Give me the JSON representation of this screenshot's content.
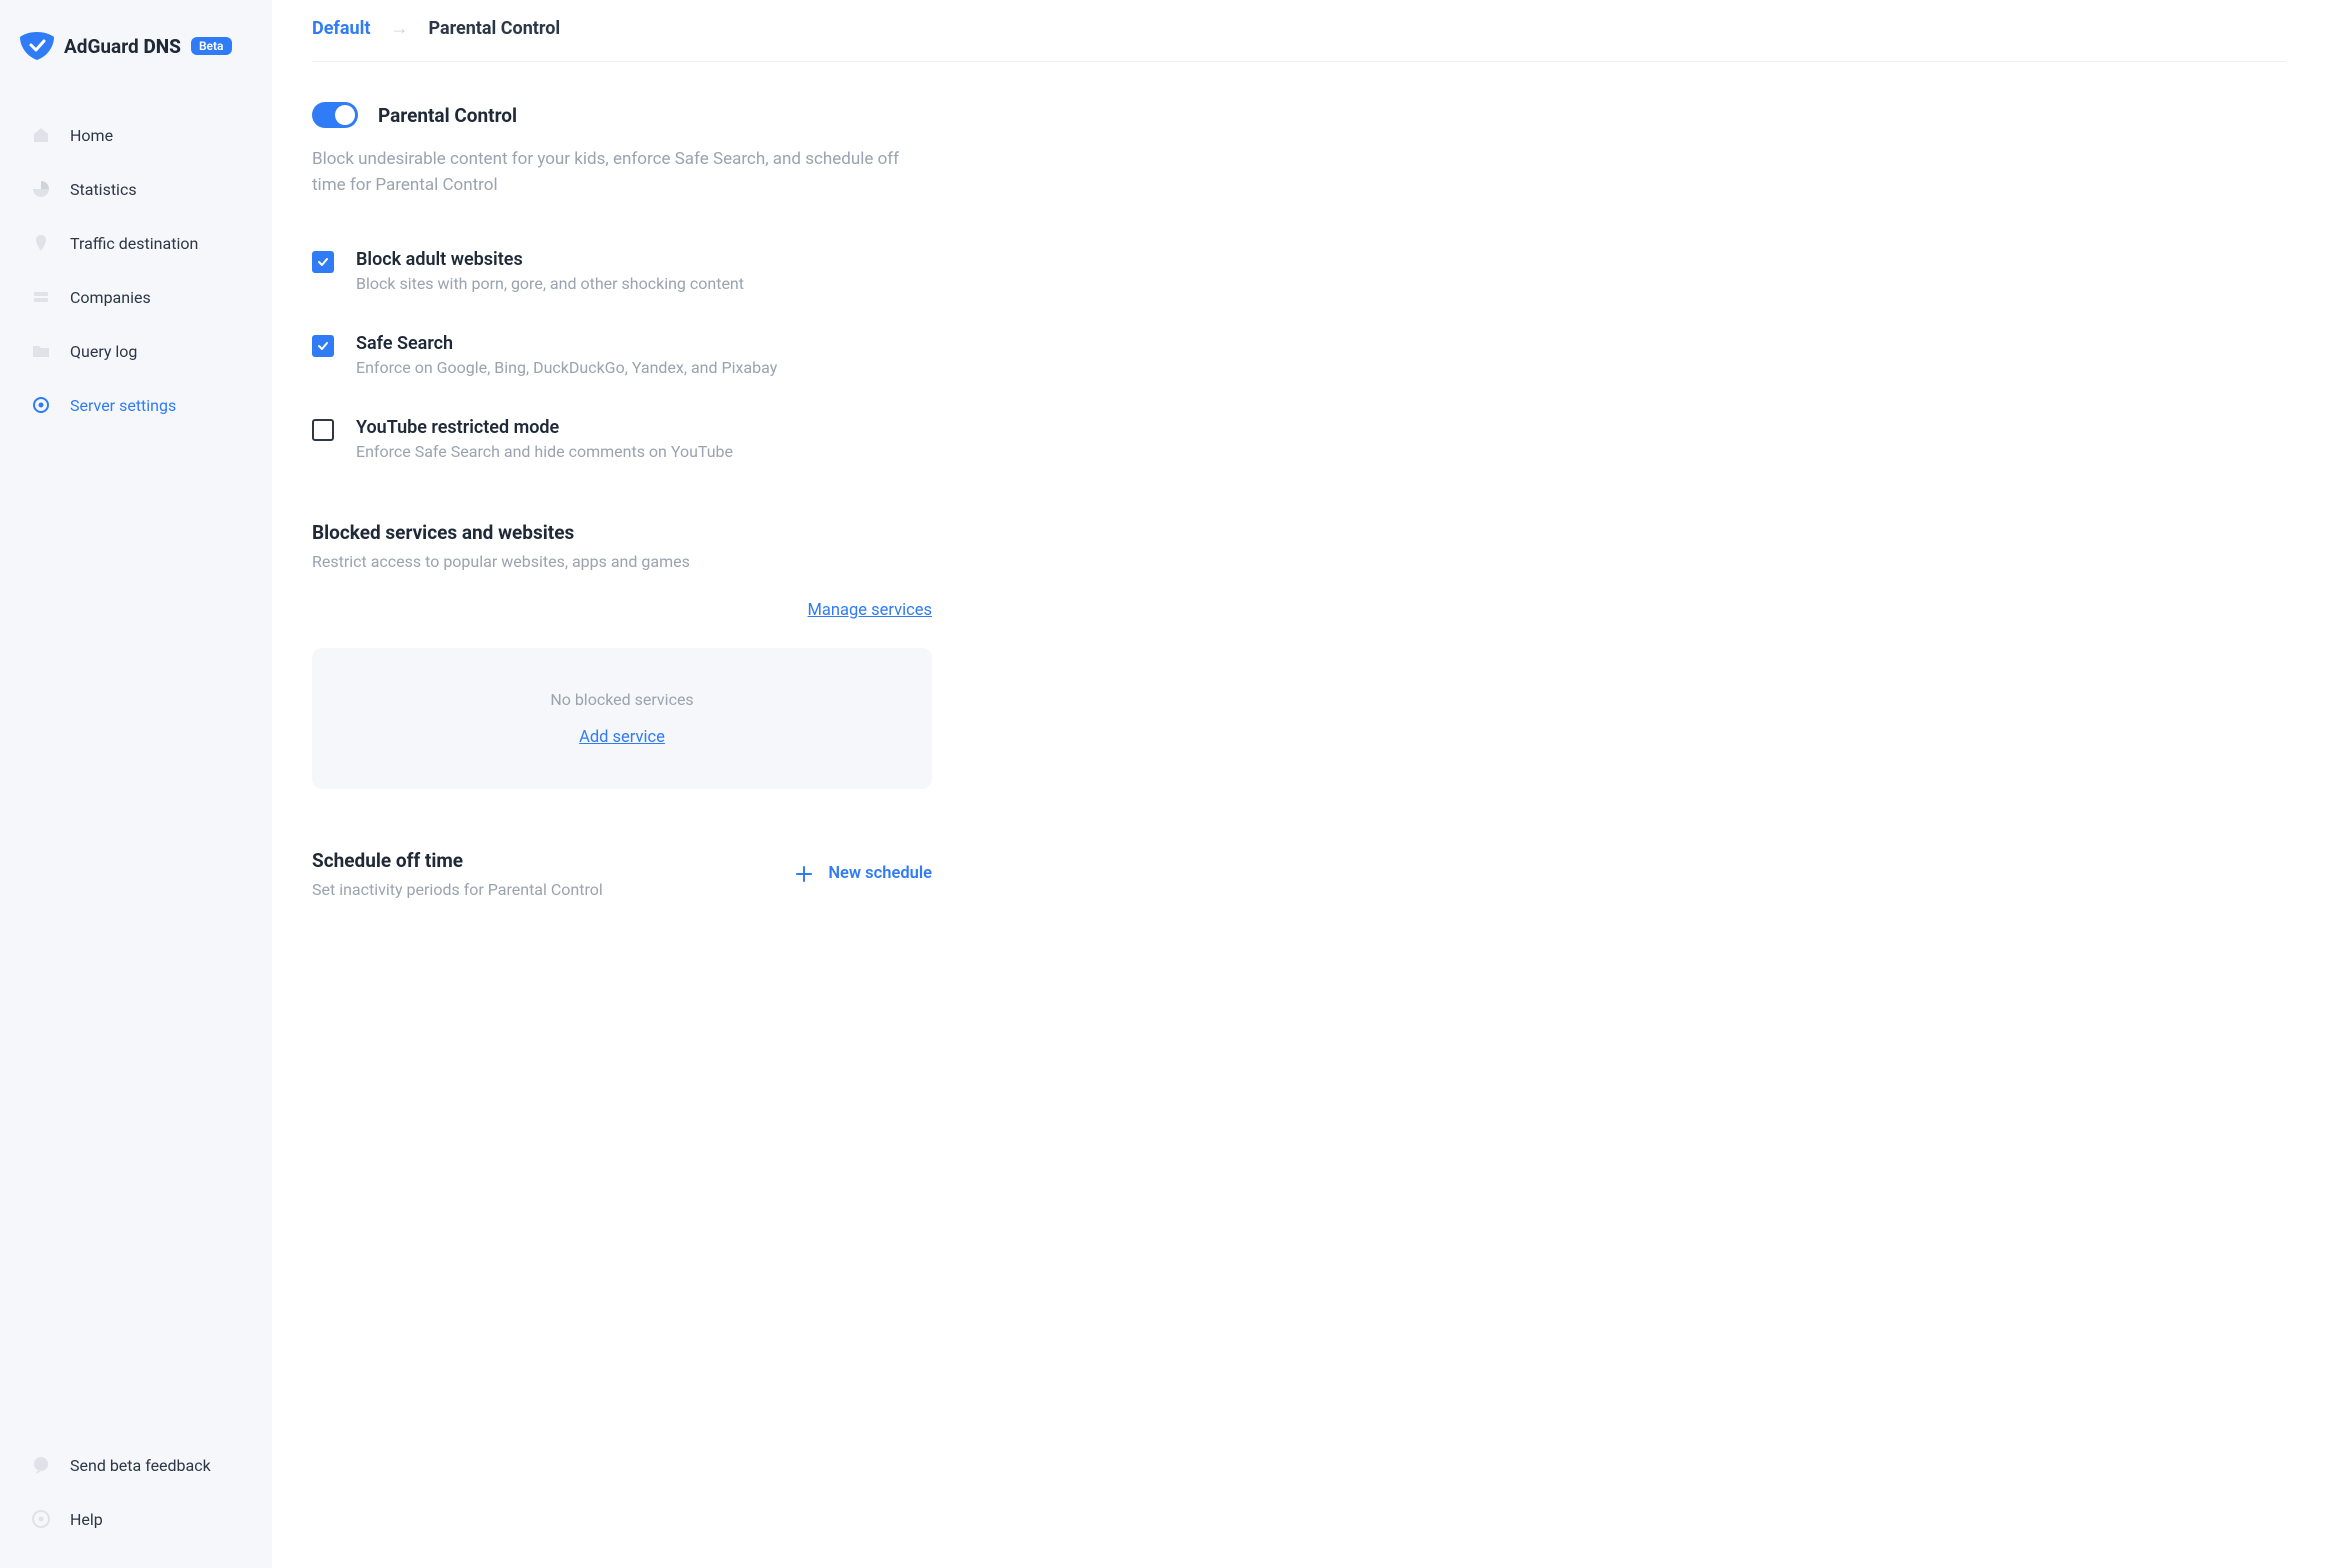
{
  "brand": {
    "name": "AdGuard",
    "product": "DNS",
    "badge": "Beta"
  },
  "sidebar": {
    "items": [
      {
        "label": "Home"
      },
      {
        "label": "Statistics"
      },
      {
        "label": "Traffic destination"
      },
      {
        "label": "Companies"
      },
      {
        "label": "Query log"
      },
      {
        "label": "Server settings"
      }
    ],
    "footer": [
      {
        "label": "Send beta feedback"
      },
      {
        "label": "Help"
      }
    ]
  },
  "breadcrumb": {
    "root": "Default",
    "current": "Parental Control"
  },
  "header": {
    "title": "Parental Control",
    "description": "Block undesirable content for your kids, enforce Safe Search, and schedule off time for Parental Control"
  },
  "options": [
    {
      "title": "Block adult websites",
      "desc": "Block sites with porn, gore, and other shocking content",
      "checked": true
    },
    {
      "title": "Safe Search",
      "desc": "Enforce on Google, Bing, DuckDuckGo, Yandex, and Pixabay",
      "checked": true
    },
    {
      "title": "YouTube restricted mode",
      "desc": "Enforce Safe Search and hide comments on YouTube",
      "checked": false
    }
  ],
  "blocked": {
    "title": "Blocked services and websites",
    "desc": "Restrict access to popular websites, apps and games",
    "manage": "Manage services",
    "empty": "No blocked services",
    "add": "Add service"
  },
  "schedule": {
    "title": "Schedule off time",
    "desc": "Set inactivity periods for Parental Control",
    "new": "New schedule"
  },
  "colors": {
    "accent": "#2f7cf6",
    "muted": "#9aa3af",
    "sidebarBg": "#f5f7fa"
  }
}
